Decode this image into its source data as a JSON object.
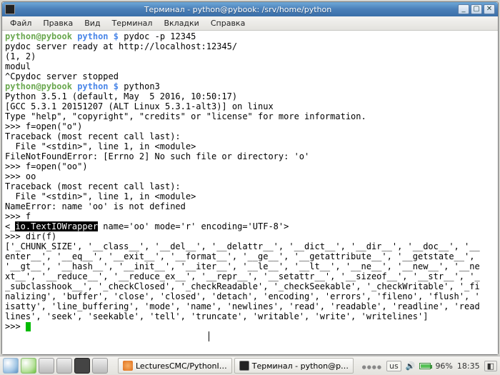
{
  "window": {
    "title": "Терминал - python@pybook: /srv/home/python"
  },
  "menubar": [
    "Файл",
    "Правка",
    "Вид",
    "Терминал",
    "Вкладки",
    "Справка"
  ],
  "term": {
    "user": "python",
    "host": "pybook",
    "cwd": "python",
    "dollar": "$",
    "cmd1": "pydoc -p 12345",
    "line_ready": "pydoc server ready at http://localhost:12345/",
    "line_tuple": "(1, 2)",
    "line_modul": "modul",
    "line_stopped": "^Cpydoc server stopped",
    "cmd2": "python3",
    "py_ver": "Python 3.5.1 (default, May  5 2016, 10:50:17)",
    "py_gcc": "[GCC 5.3.1 20151207 (ALT Linux 5.3.1-alt3)] on linux",
    "py_type": "Type \"help\", \"copyright\", \"credits\" or \"license\" for more information.",
    "p1": ">>> f=open(\"o\")",
    "tb1": "Traceback (most recent call last):",
    "tb2": "  File \"<stdin>\", line 1, in <module>",
    "err1": "FileNotFoundError: [Errno 2] No such file or directory: 'o'",
    "p2": ">>> f=open(\"oo\")",
    "p3": ">>> oo",
    "tb3": "Traceback (most recent call last):",
    "tb4": "  File \"<stdin>\", line 1, in <module>",
    "err2": "NameError: name 'oo' is not defined",
    "p4": ">>> f",
    "wrap_pre": "<_",
    "wrap_sel": "io.TextIOWrapper",
    "wrap_post": " name='oo' mode='r' encoding='UTF-8'>",
    "p5": ">>> dir(f)",
    "dir1": "['_CHUNK_SIZE', '__class__', '__del__', '__delattr__', '__dict__', '__dir__', '__doc__', '__",
    "dir2": "enter__', '__eq__', '__exit__', '__format__', '__ge__', '__getattribute__', '__getstate__',",
    "dir3": "'__gt__', '__hash__', '__init__', '__iter__', '__le__', '__lt__', '__ne__', '__new__', '__ne",
    "dir4": "xt__', '__reduce__', '__reduce_ex__', '__repr__', '__setattr__', '__sizeof__', '__str__', '_",
    "dir5": "_subclasshook__', '_checkClosed', '_checkReadable', '_checkSeekable', '_checkWritable', '_fi",
    "dir6": "nalizing', 'buffer', 'close', 'closed', 'detach', 'encoding', 'errors', 'fileno', 'flush', '",
    "dir7": "isatty', 'line_buffering', 'mode', 'name', 'newlines', 'read', 'readable', 'readline', 'read",
    "dir8": "lines', 'seek', 'seekable', 'tell', 'truncate', 'writable', 'write', 'writelines']",
    "pend": ">>> "
  },
  "taskbar": {
    "task1": "LecturesCMC/PythonI…",
    "task2": "Терминал - python@p…",
    "kb": "us",
    "batt_pct": "96%",
    "time": "18:35"
  }
}
